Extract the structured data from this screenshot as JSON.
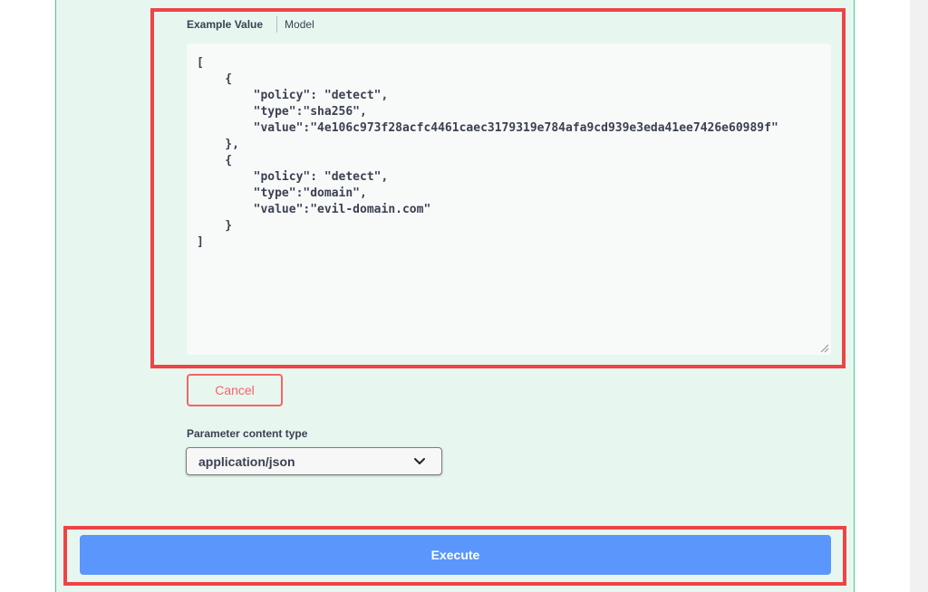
{
  "tabs": {
    "example_value": "Example Value",
    "model": "Model"
  },
  "request_body": {
    "example_json": "[\n    {\n        \"policy\": \"detect\",\n        \"type\":\"sha256\",\n        \"value\":\"4e106c973f28acfc4461caec3179319e784afa9cd939e3eda41ee7426e60989f\"\n    },\n    {\n        \"policy\": \"detect\",\n        \"type\":\"domain\",\n        \"value\":\"evil-domain.com\"\n    }\n]"
  },
  "buttons": {
    "cancel_label": "Cancel",
    "execute_label": "Execute"
  },
  "parameter_content_type": {
    "label": "Parameter content type",
    "selected": "application/json"
  },
  "icons": {
    "dropdown": "chevron-down-icon",
    "resize": "resize-grip-icon"
  },
  "colors": {
    "panel_background": "#e8f6f0",
    "panel_border": "#49cc90",
    "highlight": "#ef4444",
    "cancel": "#f56464",
    "execute": "#5a96fb"
  }
}
